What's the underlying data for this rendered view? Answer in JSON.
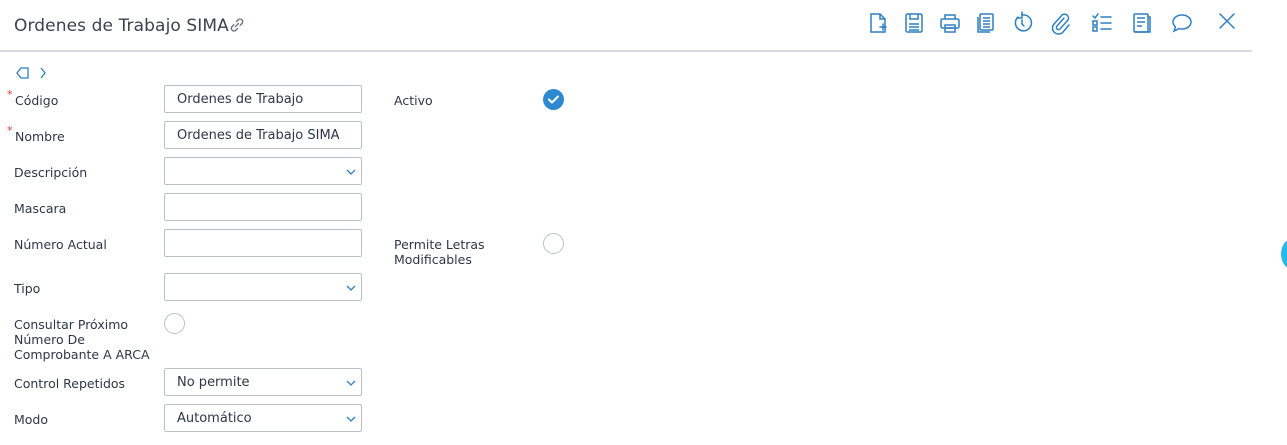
{
  "header": {
    "title": "Ordenes de Trabajo SIMA",
    "toolbar": [
      {
        "name": "new-document-icon"
      },
      {
        "name": "save-icon"
      },
      {
        "name": "print-icon"
      },
      {
        "name": "copy-icon"
      },
      {
        "name": "undo-icon"
      },
      {
        "name": "attachment-icon"
      },
      {
        "name": "checklist-icon"
      },
      {
        "name": "report-icon"
      },
      {
        "name": "comment-icon"
      },
      {
        "name": "close-icon"
      }
    ]
  },
  "form": {
    "codigo": {
      "label": "Código",
      "value": "Ordenes de Trabajo",
      "required": true
    },
    "nombre": {
      "label": "Nombre",
      "value": "Ordenes de Trabajo SIMA",
      "required": true
    },
    "descripcion": {
      "label": "Descripción",
      "value": ""
    },
    "mascara": {
      "label": "Mascara",
      "value": ""
    },
    "numero_actual": {
      "label": "Número Actual",
      "value": ""
    },
    "tipo": {
      "label": "Tipo",
      "value": ""
    },
    "consultar": {
      "label_line1": "Consultar Próximo",
      "label_line2": "Número De",
      "label_line3": "Comprobante A ARCA",
      "checked": false
    },
    "control_repetidos": {
      "label": "Control Repetidos",
      "value": "No permite"
    },
    "modo": {
      "label": "Modo",
      "value": "Automático"
    },
    "activo": {
      "label": "Activo",
      "checked": true
    },
    "permite_letras": {
      "label_line1": "Permite Letras",
      "label_line2": "Modificables",
      "checked": false
    }
  },
  "colors": {
    "accent": "#2e8ad0",
    "icon": "#2f7fc1",
    "required": "#e53935"
  }
}
